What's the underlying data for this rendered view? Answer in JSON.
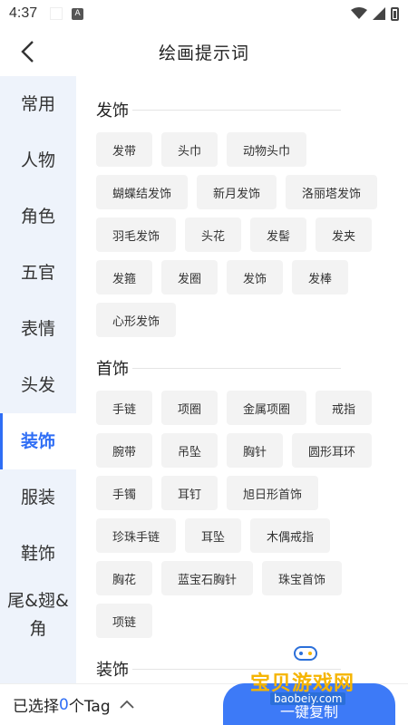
{
  "status_bar": {
    "time": "4:37",
    "a_icon": "A"
  },
  "header": {
    "title": "绘画提示词"
  },
  "sidebar": {
    "items": [
      {
        "label": "常用",
        "active": false
      },
      {
        "label": "人物",
        "active": false
      },
      {
        "label": "角色",
        "active": false
      },
      {
        "label": "五官",
        "active": false
      },
      {
        "label": "表情",
        "active": false
      },
      {
        "label": "头发",
        "active": false
      },
      {
        "label": "装饰",
        "active": true
      },
      {
        "label": "服装",
        "active": false
      },
      {
        "label": "鞋饰",
        "active": false
      },
      {
        "label": "尾&翅&角",
        "active": false
      }
    ]
  },
  "sections": [
    {
      "title": "发饰",
      "tags": [
        "发带",
        "头巾",
        "动物头巾",
        "蝴蝶结发饰",
        "新月发饰",
        "洛丽塔发饰",
        "羽毛发饰",
        "头花",
        "发髻",
        "发夹",
        "发箍",
        "发圈",
        "发饰",
        "发棒",
        "心形发饰"
      ]
    },
    {
      "title": "首饰",
      "tags": [
        "手链",
        "项圈",
        "金属项圈",
        "戒指",
        "腕带",
        "吊坠",
        "胸针",
        "圆形耳环",
        "手镯",
        "耳钉",
        "旭日形首饰",
        "珍珠手链",
        "耳坠",
        "木偶戒指",
        "胸花",
        "蓝宝石胸针",
        "珠宝首饰",
        "项链"
      ]
    },
    {
      "title": "装饰",
      "tags": []
    }
  ],
  "bottom_bar": {
    "prefix": "已选择",
    "count": "0",
    "suffix": "个Tag",
    "confirm_label": "一键复制"
  },
  "watermark": {
    "text": "宝贝游戏网",
    "url": "baobeiy.com"
  },
  "colors": {
    "accent": "#2f6ef5",
    "sidebar_bg": "#eef3fb",
    "tag_bg": "#f3f3f3"
  }
}
